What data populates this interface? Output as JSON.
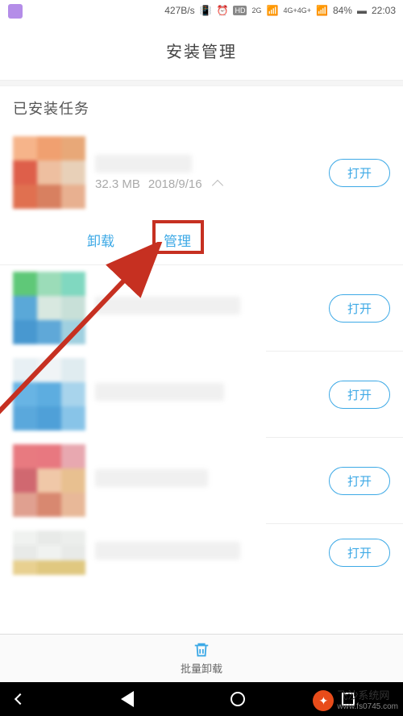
{
  "status_bar": {
    "speed": "427B/s",
    "battery_pct": "84%",
    "time": "22:03",
    "signal": "4G+4G+",
    "hd_label": "HD",
    "sig_label": "2G"
  },
  "page_title": "安装管理",
  "section_title": "已安装任务",
  "apps": [
    {
      "size": "32.3 MB",
      "date": "2018/9/16",
      "open_label": "打开",
      "expanded": true
    },
    {
      "open_label": "打开"
    },
    {
      "open_label": "打开"
    },
    {
      "open_label": "打开"
    },
    {
      "open_label": "打开"
    }
  ],
  "actions": {
    "uninstall": "卸载",
    "manage": "管理"
  },
  "bottom_bar": {
    "label": "批量卸载"
  },
  "watermark": {
    "title": "飞沙系统网",
    "url": "www.fs0745.com"
  }
}
